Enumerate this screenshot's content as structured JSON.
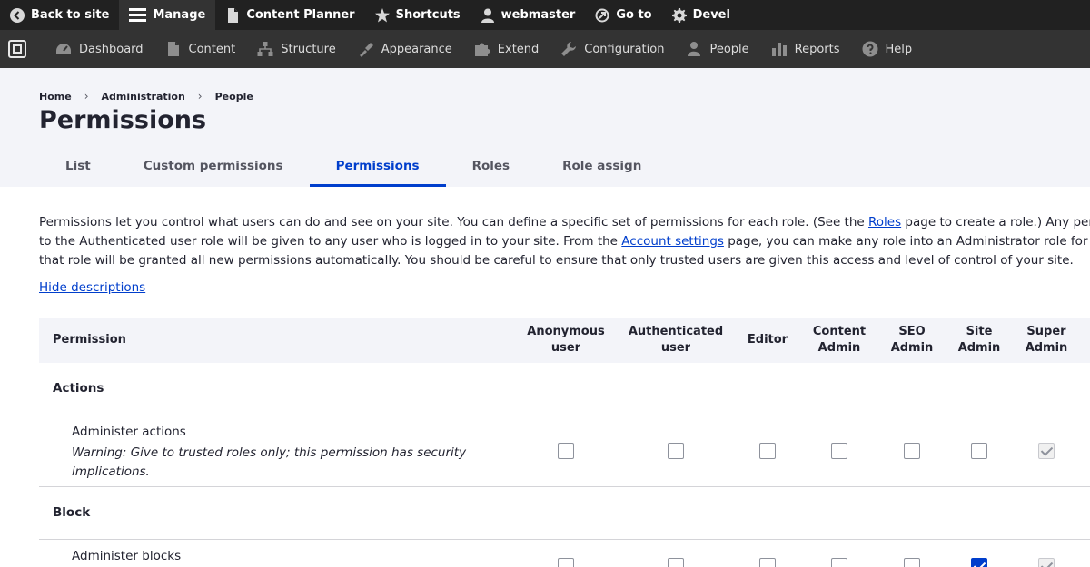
{
  "toolbar": {
    "back_to_site": "Back to site",
    "manage": "Manage",
    "content_planner": "Content Planner",
    "shortcuts": "Shortcuts",
    "user": "webmaster",
    "go_to": "Go to",
    "devel": "Devel"
  },
  "tray": {
    "dashboard": "Dashboard",
    "content": "Content",
    "structure": "Structure",
    "appearance": "Appearance",
    "extend": "Extend",
    "configuration": "Configuration",
    "people": "People",
    "reports": "Reports",
    "help": "Help"
  },
  "breadcrumb": {
    "home": "Home",
    "administration": "Administration",
    "people": "People",
    "separator": "›"
  },
  "page": {
    "title": "Permissions"
  },
  "tabs": [
    "List",
    "Custom permissions",
    "Permissions",
    "Roles",
    "Role assign"
  ],
  "intro": {
    "line1_a": "Permissions let you control what users can do and see on your site. You can define a specific set of permissions for each role. (See the ",
    "roles_link": "Roles",
    "line1_b": " page to create a role.) Any permiss",
    "line2_a": "to the Authenticated user role will be given to any user who is logged in to your site. From the ",
    "account_link": "Account settings",
    "line2_b": " page, you can make any role into an Administrator role for the si",
    "line3": "that role will be granted all new permissions automatically. You should be careful to ensure that only trusted users are given this access and level of control of your site."
  },
  "hide_descriptions": "Hide descriptions",
  "table": {
    "permission_header": "Permission",
    "roles": [
      {
        "line1": "Anonymous",
        "line2": "user"
      },
      {
        "line1": "Authenticated",
        "line2": "user"
      },
      {
        "line1": "Editor",
        "line2": ""
      },
      {
        "line1": "Content",
        "line2": "Admin"
      },
      {
        "line1": "SEO",
        "line2": "Admin"
      },
      {
        "line1": "Site",
        "line2": "Admin"
      },
      {
        "line1": "Super",
        "line2": "Admin"
      }
    ],
    "groups": [
      {
        "name": "Actions",
        "permissions": [
          {
            "name": "Administer actions",
            "description": "Warning: Give to trusted roles only; this permission has security implications.",
            "states": [
              "unchecked",
              "unchecked",
              "unchecked",
              "unchecked",
              "unchecked",
              "unchecked",
              "disabled-checked"
            ]
          }
        ]
      },
      {
        "name": "Block",
        "permissions": [
          {
            "name": "Administer blocks",
            "description": "",
            "states": [
              "unchecked",
              "unchecked",
              "unchecked",
              "unchecked",
              "unchecked",
              "checked",
              "disabled-checked"
            ]
          }
        ]
      }
    ]
  },
  "colors": {
    "toolbar_bg": "#212121",
    "tray_bg": "#333333",
    "header_bg": "#f3f4f9",
    "accent": "#003ecc",
    "text": "#222330"
  }
}
